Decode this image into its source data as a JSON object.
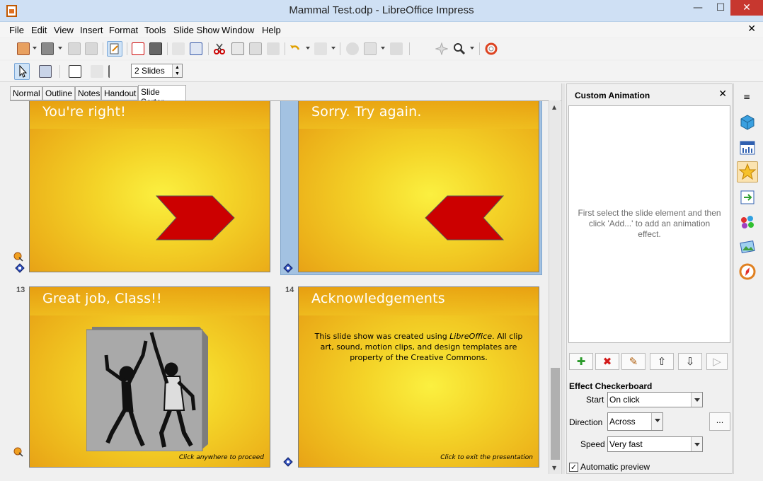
{
  "window": {
    "title": "Mammal Test.odp - LibreOffice Impress",
    "min": "—",
    "max": "☐",
    "close": "✕"
  },
  "menu": [
    "File",
    "Edit",
    "View",
    "Insert",
    "Format",
    "Tools",
    "Slide Show",
    "Window",
    "Help"
  ],
  "doc_close": "✕",
  "toolbar2": {
    "slides_count": "2 Slides"
  },
  "tabs": [
    "Normal",
    "Outline",
    "Notes",
    "Handout",
    "Slide Sorter"
  ],
  "slides": [
    {
      "title": "You're right!"
    },
    {
      "title": "Sorry.  Try again."
    },
    {
      "number": "13",
      "title": "Great job, Class!!",
      "footer": "Click anywhere to proceed"
    },
    {
      "number": "14",
      "title": "Acknowledgements",
      "body_pre": "This slide show was created using ",
      "body_em": "LibreOffice",
      "body_post": ". All clip art, sound, motion clips, and design templates are property of the Creative Commons.",
      "footer": "Click to exit the presentation"
    }
  ],
  "panel": {
    "title": "Custom Animation",
    "close": "✕",
    "hint": "First select the slide element and then click 'Add...' to add an animation effect.",
    "buttons": {
      "add": "✚",
      "remove": "✖",
      "edit": "✎",
      "up": "⇧",
      "down": "⇩",
      "play": "▷"
    },
    "effect": "Effect Checkerboard",
    "start_label": "Start",
    "start_value": "On click",
    "direction_label": "Direction",
    "direction_value": "Across",
    "more": "...",
    "speed_label": "Speed",
    "speed_value": "Very fast",
    "auto_preview": "Automatic preview",
    "auto_checked": "✓"
  },
  "colors": {
    "slide_bg": "#f4d428",
    "title_text": "#ffffff",
    "arrow_red": "#cc0000",
    "selection": "#a3c2e2"
  }
}
